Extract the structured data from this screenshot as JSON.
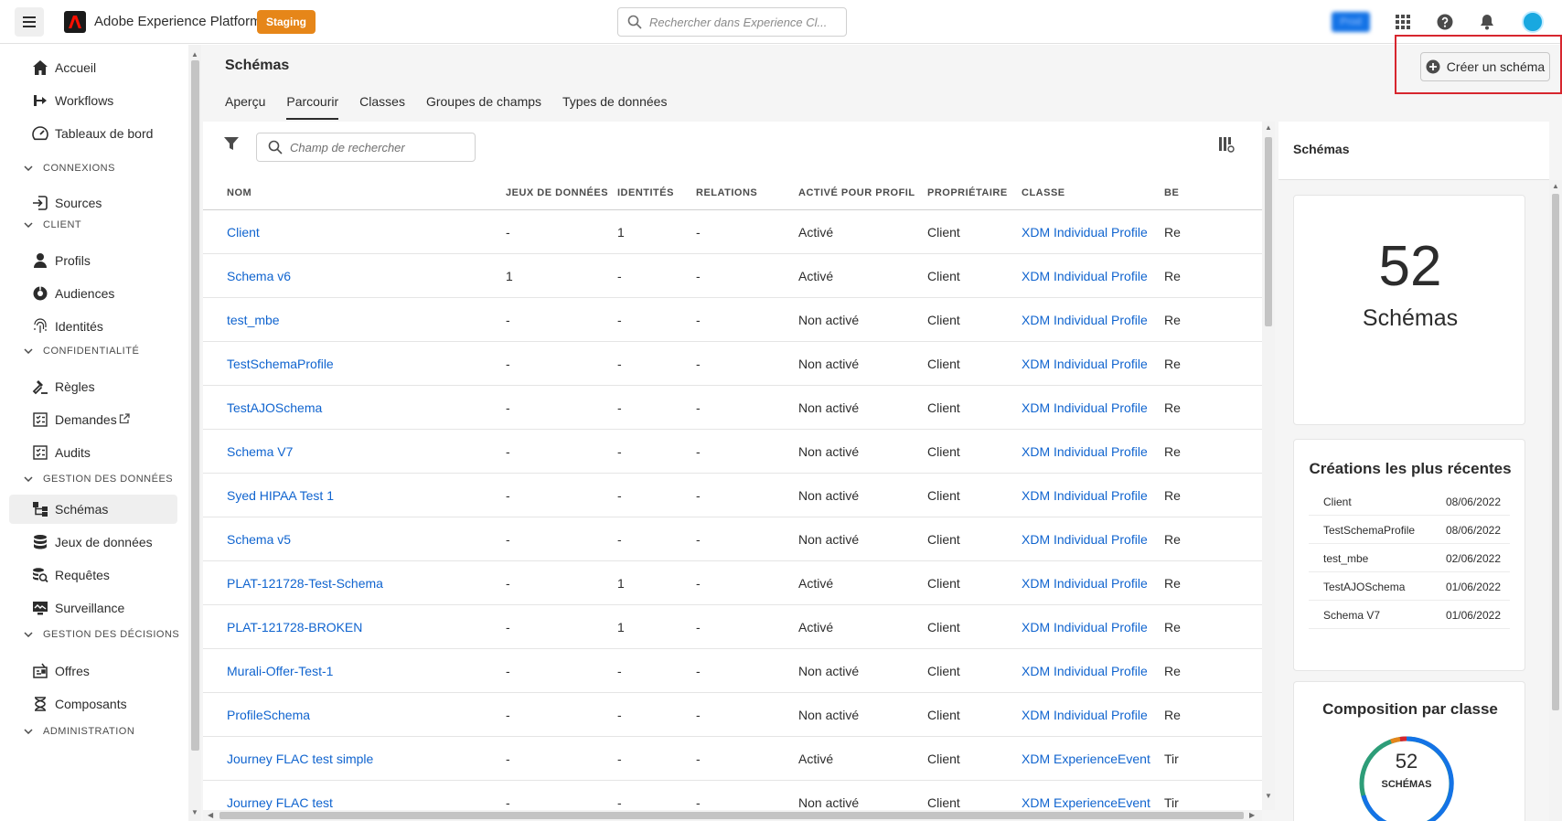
{
  "app": {
    "title": "Adobe Experience Platform",
    "environment": "Staging",
    "search_placeholder": "Rechercher dans Experience Cl...",
    "org_label": "Prod",
    "colors": {
      "accent": "#1473e6",
      "env": "#e68619",
      "link": "#1064cf",
      "highlight": "#d7262e"
    }
  },
  "sidebar": {
    "items": [
      {
        "label": "Accueil",
        "icon": "home-icon"
      },
      {
        "label": "Workflows",
        "icon": "workflow-icon"
      },
      {
        "label": "Tableaux de bord",
        "icon": "dashboard-icon"
      },
      {
        "section": "CONNEXIONS"
      },
      {
        "label": "Sources",
        "icon": "sources-icon"
      },
      {
        "section": "CLIENT"
      },
      {
        "label": "Profils",
        "icon": "profile-icon"
      },
      {
        "label": "Audiences",
        "icon": "audiences-icon"
      },
      {
        "label": "Identités",
        "icon": "fingerprint-icon"
      },
      {
        "section": "CONFIDENTIALITÉ"
      },
      {
        "label": "Règles",
        "icon": "gavel-icon"
      },
      {
        "label": "Demandes",
        "icon": "requests-icon",
        "external": "external-link-icon"
      },
      {
        "label": "Audits",
        "icon": "audits-icon"
      },
      {
        "section": "GESTION DES DONNÉES"
      },
      {
        "label": "Schémas",
        "icon": "schema-icon",
        "active": true
      },
      {
        "label": "Jeux de données",
        "icon": "database-icon"
      },
      {
        "label": "Requêtes",
        "icon": "query-icon"
      },
      {
        "label": "Surveillance",
        "icon": "monitoring-icon"
      },
      {
        "section": "GESTION DES DÉCISIONS"
      },
      {
        "label": "Offres",
        "icon": "offers-icon"
      },
      {
        "label": "Composants",
        "icon": "components-icon"
      },
      {
        "section": "ADMINISTRATION"
      }
    ]
  },
  "main": {
    "title": "Schémas",
    "create_button": "Créer un schéma",
    "tabs": [
      {
        "label": "Aperçu",
        "selected": false
      },
      {
        "label": "Parcourir",
        "selected": true
      },
      {
        "label": "Classes",
        "selected": false
      },
      {
        "label": "Groupes de champs",
        "selected": false
      },
      {
        "label": "Types de données",
        "selected": false
      }
    ],
    "search_placeholder": "Champ de rechercher"
  },
  "table": {
    "columns": [
      "NOM",
      "JEUX DE DONNÉES",
      "IDENTITÉS",
      "RELATIONS",
      "ACTIVÉ POUR PROFIL",
      "PROPRIÉTAIRE",
      "CLASSE",
      "BE"
    ],
    "rows": [
      [
        "Client",
        "-",
        "1",
        "-",
        "Activé",
        "Client",
        "XDM Individual Profile",
        "Re"
      ],
      [
        "Schema v6",
        "1",
        "-",
        "-",
        "Activé",
        "Client",
        "XDM Individual Profile",
        "Re"
      ],
      [
        "test_mbe",
        "-",
        "-",
        "-",
        "Non activé",
        "Client",
        "XDM Individual Profile",
        "Re"
      ],
      [
        "TestSchemaProfile",
        "-",
        "-",
        "-",
        "Non activé",
        "Client",
        "XDM Individual Profile",
        "Re"
      ],
      [
        "TestAJOSchema",
        "-",
        "-",
        "-",
        "Non activé",
        "Client",
        "XDM Individual Profile",
        "Re"
      ],
      [
        "Schema V7",
        "-",
        "-",
        "-",
        "Non activé",
        "Client",
        "XDM Individual Profile",
        "Re"
      ],
      [
        "Syed HIPAA Test 1",
        "-",
        "-",
        "-",
        "Non activé",
        "Client",
        "XDM Individual Profile",
        "Re"
      ],
      [
        "Schema v5",
        "-",
        "-",
        "-",
        "Non activé",
        "Client",
        "XDM Individual Profile",
        "Re"
      ],
      [
        "PLAT-121728-Test-Schema",
        "-",
        "1",
        "-",
        "Activé",
        "Client",
        "XDM Individual Profile",
        "Re"
      ],
      [
        "PLAT-121728-BROKEN",
        "-",
        "1",
        "-",
        "Activé",
        "Client",
        "XDM Individual Profile",
        "Re"
      ],
      [
        "Murali-Offer-Test-1",
        "-",
        "-",
        "-",
        "Non activé",
        "Client",
        "XDM Individual Profile",
        "Re"
      ],
      [
        "ProfileSchema",
        "-",
        "-",
        "-",
        "Non activé",
        "Client",
        "XDM Individual Profile",
        "Re"
      ],
      [
        "Journey FLAC test simple",
        "-",
        "-",
        "-",
        "Activé",
        "Client",
        "XDM ExperienceEvent",
        "Tir"
      ],
      [
        "Journey FLAC test",
        "-",
        "-",
        "-",
        "Non activé",
        "Client",
        "XDM ExperienceEvent",
        "Tir"
      ]
    ]
  },
  "rail": {
    "title": "Schémas",
    "total": "52",
    "total_label": "Schémas",
    "recent_title": "Créations les plus récentes",
    "recent": [
      {
        "name": "Client",
        "date": "08/06/2022"
      },
      {
        "name": "TestSchemaProfile",
        "date": "08/06/2022"
      },
      {
        "name": "test_mbe",
        "date": "02/06/2022"
      },
      {
        "name": "TestAJOSchema",
        "date": "01/06/2022"
      },
      {
        "name": "Schema V7",
        "date": "01/06/2022"
      }
    ],
    "composition_title": "Composition par classe",
    "donut_count": "52",
    "donut_label": "SCHÉMAS"
  }
}
